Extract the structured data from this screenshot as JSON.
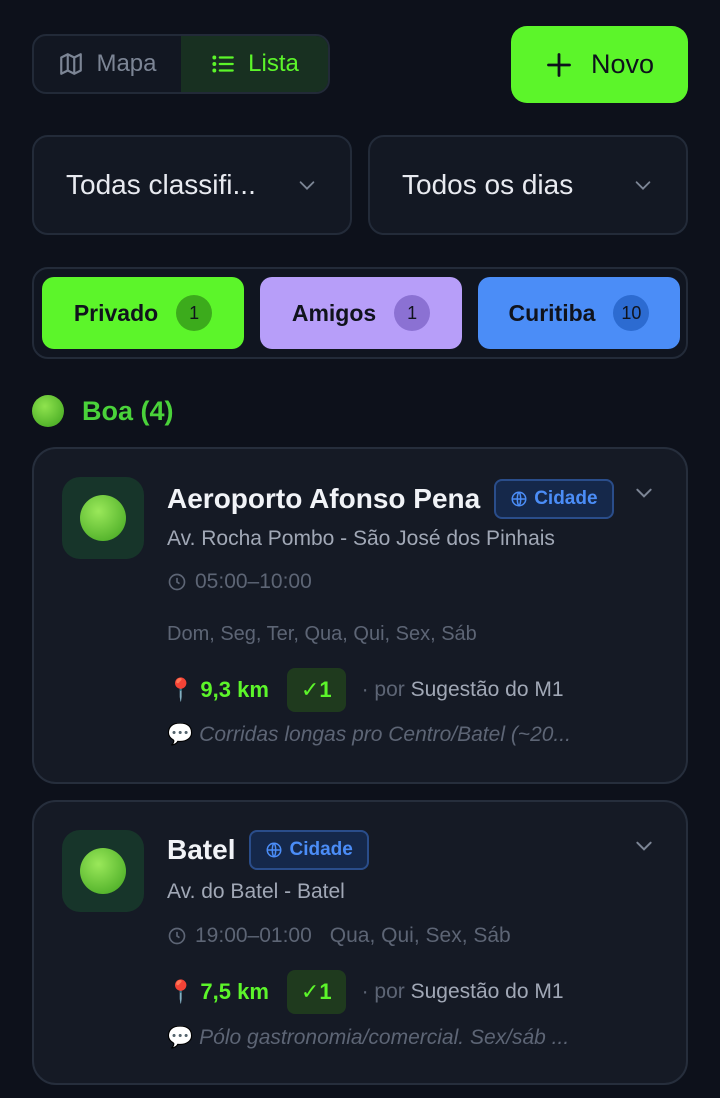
{
  "toolbar": {
    "map_label": "Mapa",
    "list_label": "Lista",
    "new_label": "Novo"
  },
  "filters": {
    "classification": "Todas classifi...",
    "days": "Todos os dias"
  },
  "tags": [
    {
      "label": "Privado",
      "count": "1",
      "color": "#5cf52a"
    },
    {
      "label": "Amigos",
      "count": "1",
      "color": "#b79ef9"
    },
    {
      "label": "Curitiba",
      "count": "10",
      "color": "#4b8df7"
    }
  ],
  "group": {
    "title": "Boa (4)",
    "color": "#4ad23a"
  },
  "cards": [
    {
      "name": "Aeroporto Afonso Pena",
      "badge": "Cidade",
      "address": "Av. Rocha Pombo - São José dos Pinhais",
      "hours": "05:00–10:00",
      "days": "Dom, Seg, Ter, Qua, Qui, Sex, Sáb",
      "distance": "9,3 km",
      "confirmations": "✓1",
      "by": "· por",
      "author": "Sugestão do M1",
      "note": "Corridas longas pro Centro/Batel (~20..."
    },
    {
      "name": "Batel",
      "badge": "Cidade",
      "address": "Av. do Batel - Batel",
      "hours": "19:00–01:00",
      "days": "Qua, Qui, Sex, Sáb",
      "distance": "7,5 km",
      "confirmations": "✓1",
      "by": "· por",
      "author": "Sugestão do M1",
      "note": "Pólo gastronomia/comercial. Sex/sáb ..."
    }
  ],
  "colors": {
    "background": "#0d111b",
    "accent": "#5cf52a",
    "card": "#151a25"
  }
}
